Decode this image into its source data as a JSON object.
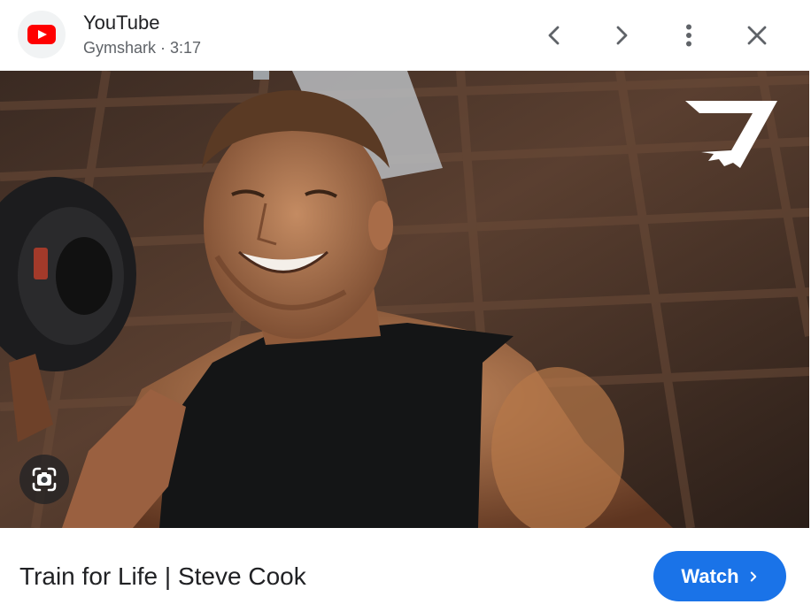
{
  "header": {
    "source_name": "YouTube",
    "channel": "Gymshark",
    "separator": " · ",
    "duration": "3:17",
    "icons": {
      "source": "youtube-logo-icon",
      "prev": "chevron-left-icon",
      "next": "chevron-right-icon",
      "more": "more-vert-icon",
      "close": "close-icon"
    }
  },
  "media": {
    "brand_logo": "gymshark-logo-icon",
    "lens_icon": "google-lens-icon"
  },
  "footer": {
    "video_title": "Train for Life | Steve Cook",
    "watch_label": "Watch",
    "watch_icon": "chevron-right-icon"
  },
  "colors": {
    "accent": "#1a73e8",
    "youtube_red": "#ff0000",
    "text_primary": "#202124",
    "text_secondary": "#5f6368"
  }
}
